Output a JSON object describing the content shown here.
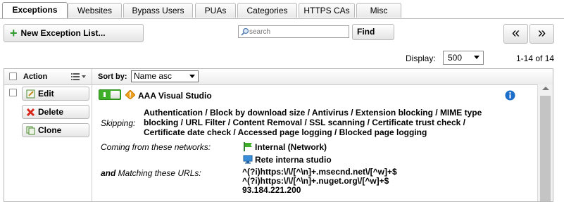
{
  "tabs": [
    {
      "label": "Exceptions",
      "active": true
    },
    {
      "label": "Websites"
    },
    {
      "label": "Bypass Users"
    },
    {
      "label": "PUAs"
    },
    {
      "label": "Categories"
    },
    {
      "label": "HTTPS CAs"
    },
    {
      "label": "Misc"
    }
  ],
  "toolbar": {
    "new_label": "New Exception List...",
    "search_placeholder": "search",
    "find_label": "Find",
    "prev_label": "«",
    "next_label": "»"
  },
  "display": {
    "label": "Display:",
    "value": "500",
    "count": "1-14 of 14"
  },
  "table": {
    "action_header": "Action",
    "sort_label": "Sort by:",
    "sort_value": "Name asc",
    "actions": {
      "edit": "Edit",
      "delete": "Delete",
      "clone": "Clone"
    },
    "row": {
      "title": "AAA Visual Studio",
      "enabled": true,
      "skipping_label": "Skipping:",
      "skipping": [
        "Authentication / Block by download size / Antivirus / Extension blocking / MIME type",
        "blocking / URL Filter / Content Removal / SSL scanning / Certificate trust check /",
        "Certificate date check / Accessed page logging / Blocked page logging"
      ],
      "networks_label": "Coming from these networks:",
      "networks": [
        "Internal (Network)",
        "Rete interna studio"
      ],
      "urls_and": "and",
      "urls_label": " Matching these URLs:",
      "urls": [
        "^(?i)https:\\/\\/[^\\n]+.msecnd.net\\/[^w]+$",
        "^(?i)https:\\/\\/[^\\n]+.nuget.org\\/[^w]+$",
        "93.184.221.200"
      ]
    }
  },
  "colors": {
    "toggle_on": "#3fae29",
    "delete_icon": "#d9261c",
    "info_icon": "#1c6fc9",
    "warning_icon": "#f0a020"
  }
}
